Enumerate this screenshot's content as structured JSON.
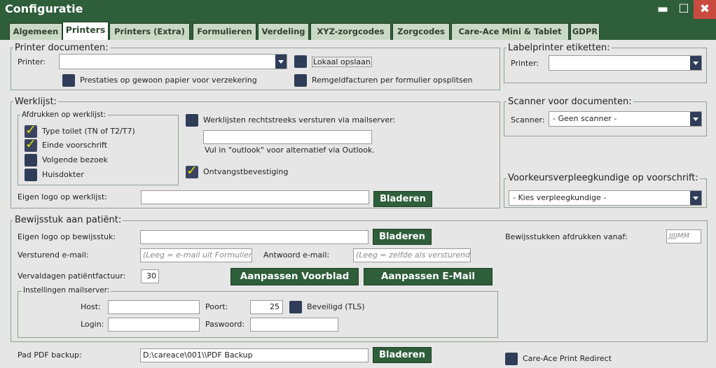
{
  "window": {
    "title": "Configuratie"
  },
  "tabs": [
    "Algemeen",
    "Printers",
    "Printers (Extra)",
    "Formulieren",
    "Verdeling",
    "XYZ-zorgcodes",
    "Zorgcodes",
    "Care-Ace Mini & Tablet",
    "GDPR"
  ],
  "printer_documenten": {
    "legend": "Printer documenten:",
    "printer_label": "Printer:",
    "printer_value": "",
    "lokaal_opslaan": "Lokaal opslaan",
    "prestaties": "Prestaties op gewoon papier voor verzekering",
    "remgeld": "Remgeldfacturen per formulier opsplitsen"
  },
  "labelprinter": {
    "legend": "Labelprinter etiketten:",
    "printer_label": "Printer:",
    "printer_value": ""
  },
  "werklijst": {
    "legend": "Werklijst:",
    "afdrukken_legend": "Afdrukken op werklijst:",
    "items": [
      {
        "label": "Type toilet (TN of T2/T7)",
        "checked": true
      },
      {
        "label": "Einde voorschrift",
        "checked": true
      },
      {
        "label": "Volgende bezoek",
        "checked": false
      },
      {
        "label": "Huisdokter",
        "checked": false
      }
    ],
    "mailserver_label": "Werklijsten rechtstreeks versturen via mailserver:",
    "mail_value": "",
    "outlook_hint": "Vul in \"outlook\" voor alternatief via Outlook.",
    "ontvangst": "Ontvangstbevestiging",
    "logo_label": "Eigen logo op  werklijst:",
    "logo_value": "",
    "bladeren": "Bladeren"
  },
  "scanner": {
    "legend": "Scanner voor documenten:",
    "label": "Scanner:",
    "value": "- Geen scanner -"
  },
  "voorkeur": {
    "legend": "Voorkeursverpleegkundige op voorschrift:",
    "value": "- Kies verpleegkundige -"
  },
  "bewijsstuk": {
    "legend": "Bewijsstuk aan patiënt:",
    "logo_label": "Eigen logo op bewijsstuk:",
    "logo_value": "",
    "bladeren": "Bladeren",
    "afdrukken_vanaf_label": "Bewijsstukken afdrukken vanaf:",
    "afdrukken_vanaf_ph": "JJJJMM",
    "versturend_label": "Versturend e-mail:",
    "versturend_ph": "(Leeg = e-mail uit Formulieren)",
    "antwoord_label": "Antwoord e-mail:",
    "antwoord_ph": "(Leeg = zelfde als versturend)",
    "vervaldagen_label": "Vervaldagen patiëntfactuur:",
    "vervaldagen_value": "30",
    "aanpassen_voorblad": "Aanpassen Voorblad",
    "aanpassen_email": "Aanpassen E-Mail",
    "mailserver_legend": "Instellingen mailserver:",
    "host_label": "Host:",
    "host_value": "",
    "poort_label": "Poort:",
    "poort_value": "25",
    "beveiligd": "Beveiligd (TLS)",
    "login_label": "Login:",
    "login_value": "",
    "paswoord_label": "Paswoord:",
    "paswoord_value": ""
  },
  "pdf_backup": {
    "label": "Pad PDF backup:",
    "value": "D:\\careace\\001\\\\PDF Backup",
    "bladeren": "Bladeren"
  },
  "print_redirect": "Care-Ace Print Redirect",
  "colors": {
    "accent": "#2e5e3a",
    "checkbox": "#2f3d59",
    "checkmark": "#d6e000"
  }
}
